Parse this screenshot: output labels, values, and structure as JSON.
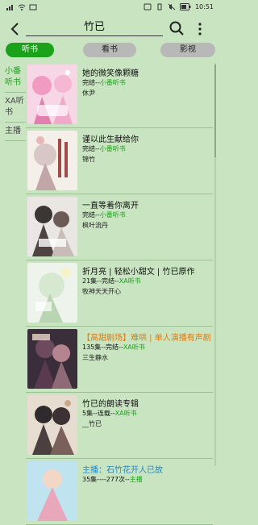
{
  "status": {
    "time": "10:51",
    "battery": "▮"
  },
  "search": {
    "query": "竹已"
  },
  "tabs": [
    {
      "label": "听书"
    },
    {
      "label": "看书"
    },
    {
      "label": "影视"
    }
  ],
  "sidebar": [
    {
      "label": "小番听书"
    },
    {
      "label": "XA听书"
    },
    {
      "label": "主播"
    }
  ],
  "items": [
    {
      "title": "她的微笑像颗糖",
      "meta_prefix": "完结--",
      "meta_source": "小番听书",
      "author": "休尹"
    },
    {
      "title": "谨以此生献给你",
      "meta_prefix": "完结--",
      "meta_source": "小番听书",
      "author": "锦竹"
    },
    {
      "title": "一直等着你离开",
      "meta_prefix": "完结--",
      "meta_source": "小番听书",
      "author": "枫叶流丹"
    },
    {
      "title": "折月亮 | 轻松小甜文 | 竹已原作",
      "meta_prefix": "21集--完结--",
      "meta_source": "XA听书",
      "author": "牧神天天开心"
    },
    {
      "title": "【高甜剧场】难哄 | 单人演播有声剧",
      "meta_prefix": "135集--完结--",
      "meta_source": "XA听书",
      "author": "三生静水"
    },
    {
      "title": "竹已的朗读专辑",
      "meta_prefix": "5集--连载--",
      "meta_source": "XA听书",
      "author": "__竹已"
    },
    {
      "title": "主播：石竹花开人已故",
      "meta_prefix": "35集----277次--",
      "meta_source": "主播",
      "author": ""
    }
  ]
}
